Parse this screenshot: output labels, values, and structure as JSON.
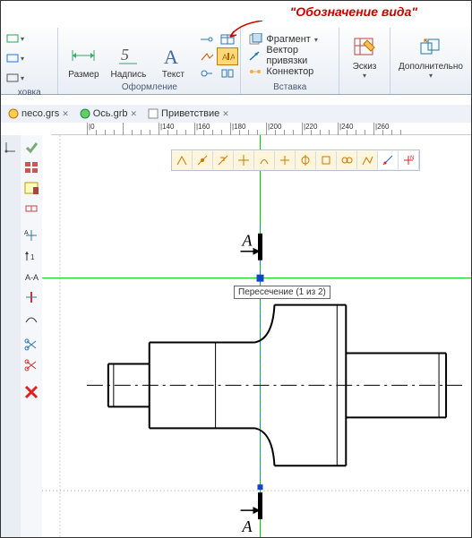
{
  "callout": "\"Обозначение вида\"",
  "ribbon": {
    "groups": {
      "left_partial": {
        "label": "ховка"
      },
      "design": {
        "label": "Оформление",
        "size": "Размер",
        "caption": "Надпись",
        "text": "Текст"
      },
      "insert": {
        "label": "Вставка",
        "fragment": "Фрагмент",
        "binding_vector": "Вектор привязки",
        "connector": "Коннектор"
      },
      "sketch": {
        "label": "Эскиз"
      },
      "more": {
        "label": "Дополнительно"
      }
    }
  },
  "doc_tabs": [
    {
      "name": "neco.grs"
    },
    {
      "name": "Ось.grb"
    },
    {
      "name": "Приветствие"
    }
  ],
  "ruler": {
    "marks": [
      {
        "pos": 40,
        "label": "0"
      },
      {
        "pos": 80,
        "label": ""
      },
      {
        "pos": 120,
        "label": "140"
      },
      {
        "pos": 160,
        "label": "160"
      },
      {
        "pos": 200,
        "label": "180"
      },
      {
        "pos": 240,
        "label": "200"
      },
      {
        "pos": 280,
        "label": "220"
      },
      {
        "pos": 320,
        "label": "240"
      },
      {
        "pos": 360,
        "label": "260"
      }
    ]
  },
  "tooltip": "Пересечение (1 из 2)",
  "section_label": "А"
}
